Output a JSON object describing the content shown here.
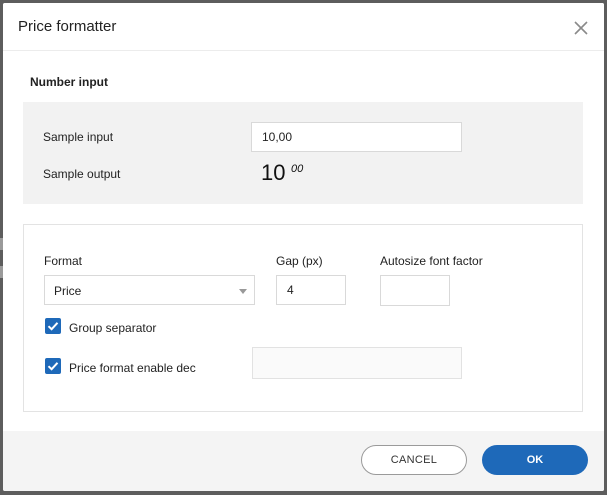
{
  "dialog": {
    "title": "Price formatter",
    "close_icon": "close-icon"
  },
  "number_input": {
    "section_title": "Number input",
    "sample_input_label": "Sample input",
    "sample_input_value": "10,00",
    "sample_output_label": "Sample output",
    "sample_output_integer": "10",
    "sample_output_decimals": "00"
  },
  "format_section": {
    "format_label": "Format",
    "format_selected": "Price",
    "gap_label": "Gap (px)",
    "gap_value": "4",
    "autosize_label": "Autosize font factor",
    "autosize_value": "",
    "group_separator_label": "Group separator",
    "group_separator_checked": true,
    "price_format_label": "Price format enable dec",
    "price_format_checked": true,
    "price_format_value": ""
  },
  "footer": {
    "cancel_label": "CANCEL",
    "ok_label": "OK"
  },
  "colors": {
    "accent": "#1e69b9",
    "overlay": "#5d5d5d"
  }
}
